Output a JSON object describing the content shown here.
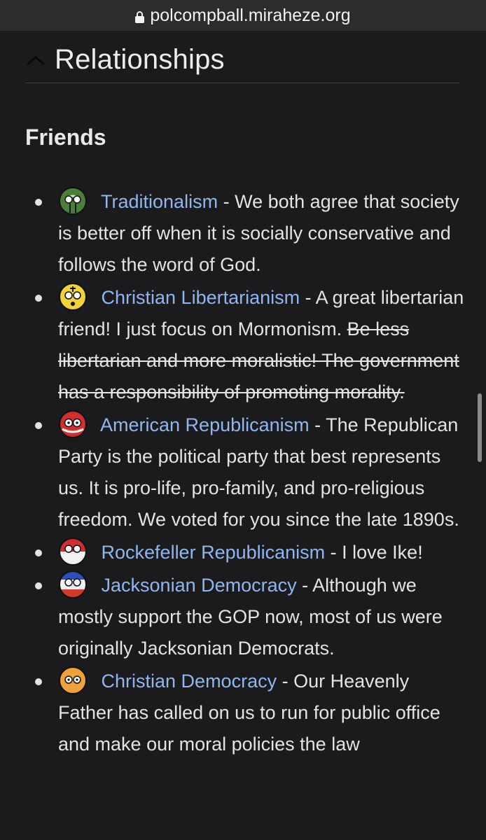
{
  "url_bar": {
    "domain": "polcompball.miraheze.org"
  },
  "section": {
    "title": "Relationships",
    "subheading": "Friends"
  },
  "friends": [
    {
      "name": "Traditionalism",
      "desc": " - We both agree that society is better off when it is socially conservative and follows the word of God."
    },
    {
      "name": "Christian Libertarianism",
      "desc": " - A great libertarian friend! I just focus on Mormonism. ",
      "struck": "Be less libertarian and more moralistic! The government has a responsibility of promoting morality."
    },
    {
      "name": "American Republicanism",
      "desc": " - The Republican Party is the political party that best represents us. It is pro-life, pro-family, and pro-religious freedom. We voted for you since the late 1890s."
    },
    {
      "name": "Rockefeller Republicanism",
      "desc": " - I love Ike!"
    },
    {
      "name": "Jacksonian Democracy",
      "desc": " - Although we mostly support the GOP now, most of us were originally Jacksonian Democrats."
    },
    {
      "name": "Christian Democracy",
      "desc": " - Our Heavenly Father has called on us to run for public office and make our moral policies the law"
    }
  ],
  "icons": {
    "lock": "lock-icon",
    "collapse": "chevron-up-icon"
  },
  "colors": {
    "background": "#1b1b1d",
    "link": "#8fb6f0",
    "text": "#e3e3e3"
  }
}
